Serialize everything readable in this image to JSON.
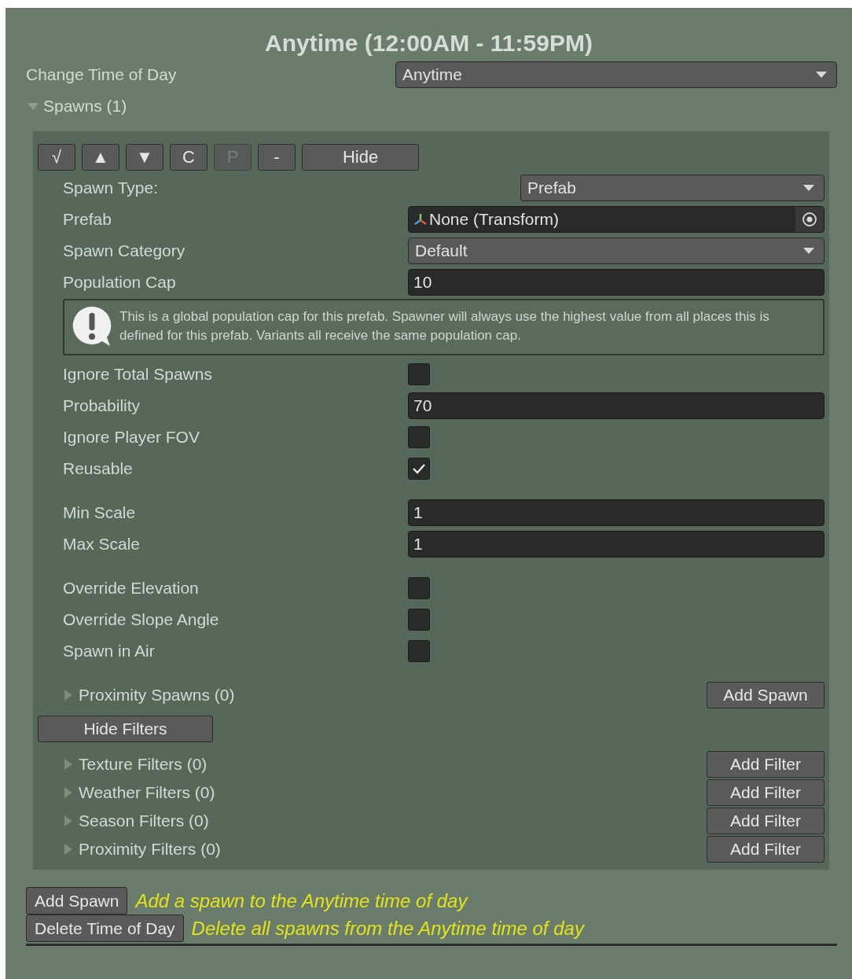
{
  "title": "Anytime (12:00AM - 11:59PM)",
  "time_of_day": {
    "label": "Change Time of Day",
    "value": "Anytime"
  },
  "spawns_foldout": {
    "label": "Spawns (1)",
    "expanded": true
  },
  "toolbar": [
    {
      "label": "√",
      "disabled": false,
      "wide": false
    },
    {
      "label": "▲",
      "disabled": false,
      "wide": false
    },
    {
      "label": "▼",
      "disabled": false,
      "wide": false
    },
    {
      "label": "C",
      "disabled": false,
      "wide": false
    },
    {
      "label": "P",
      "disabled": true,
      "wide": false
    },
    {
      "label": "-",
      "disabled": false,
      "wide": false
    },
    {
      "label": "Hide",
      "disabled": false,
      "wide": true
    }
  ],
  "field_groups": [
    [
      {
        "kind": "type-select",
        "label": "Spawn Type:",
        "value": "Prefab"
      },
      {
        "kind": "object",
        "label": "Prefab",
        "value": "None (Transform)"
      },
      {
        "kind": "dropdown",
        "label": "Spawn Category",
        "value": "Default"
      },
      {
        "kind": "number",
        "label": "Population Cap",
        "value": "10"
      },
      {
        "kind": "help",
        "text": "This is a global population cap for this prefab. Spawner will always use the highest value from all places this is defined for this prefab. Variants all receive the same population cap."
      },
      {
        "kind": "checkbox",
        "label": "Ignore Total Spawns",
        "checked": false
      },
      {
        "kind": "number",
        "label": "Probability",
        "value": "70"
      },
      {
        "kind": "checkbox",
        "label": "Ignore Player FOV",
        "checked": false
      },
      {
        "kind": "checkbox",
        "label": "Reusable",
        "checked": true
      }
    ],
    [
      {
        "kind": "number",
        "label": "Min Scale",
        "value": "1"
      },
      {
        "kind": "number",
        "label": "Max Scale",
        "value": "1"
      }
    ],
    [
      {
        "kind": "checkbox",
        "label": "Override Elevation",
        "checked": false
      },
      {
        "kind": "checkbox",
        "label": "Override Slope Angle",
        "checked": false
      },
      {
        "kind": "checkbox",
        "label": "Spawn in Air",
        "checked": false
      }
    ]
  ],
  "proximity_spawns": {
    "label": "Proximity Spawns (0)",
    "expanded": false,
    "button": "Add Spawn"
  },
  "hide_filters_button": "Hide Filters",
  "filters": [
    {
      "label": "Texture Filters (0)",
      "expanded": false,
      "button": "Add Filter"
    },
    {
      "label": "Weather Filters (0)",
      "expanded": false,
      "button": "Add Filter"
    },
    {
      "label": "Season Filters (0)",
      "expanded": false,
      "button": "Add Filter"
    },
    {
      "label": "Proximity Filters (0)",
      "expanded": false,
      "button": "Add Filter"
    }
  ],
  "actions": [
    {
      "button": "Add Spawn",
      "hint": "Add a spawn to the Anytime time of day"
    },
    {
      "button": "Delete Time of Day",
      "hint": "Delete all spawns from the Anytime time of day"
    }
  ]
}
